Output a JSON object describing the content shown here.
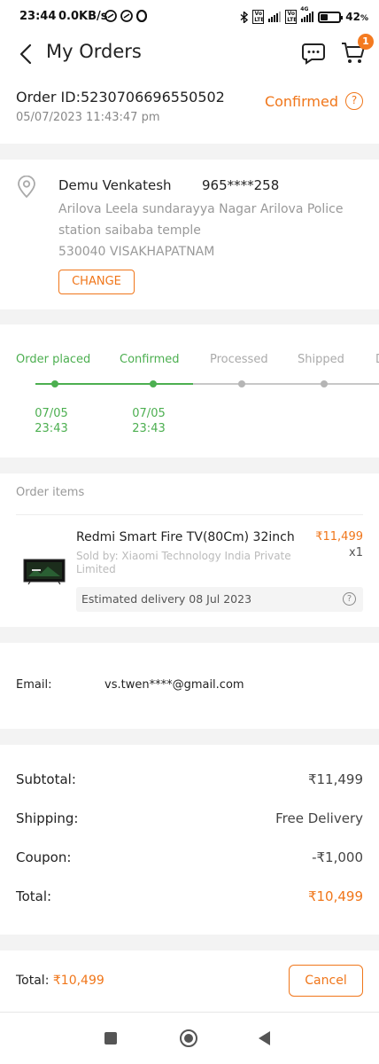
{
  "status_bar": {
    "time": "23:44",
    "speed": "0.0KB/s",
    "battery": "42",
    "battery_unit": "%",
    "network": "4G",
    "volte_1": "Vo LTE",
    "volte_2": "Vo LTE",
    "battery_level": 0.42
  },
  "header": {
    "title": "My Orders",
    "cart_count": "1"
  },
  "order": {
    "id": "Order ID:5230706696550502",
    "date": "05/07/2023 11:43:47 pm",
    "status": "Confirmed"
  },
  "address": {
    "name": "Demu Venkatesh",
    "phone": "965****258",
    "line": "Arilova Leela sundarayya Nagar Arilova Police station saibaba temple",
    "city": "530040 VISAKHAPATNAM",
    "change_label": "CHANGE"
  },
  "tracker": {
    "steps": [
      {
        "label": "Order placed",
        "done": true,
        "date": "07/05",
        "time": "23:43"
      },
      {
        "label": "Confirmed",
        "done": true,
        "date": "07/05",
        "time": "23:43"
      },
      {
        "label": "Processed",
        "done": false
      },
      {
        "label": "Shipped",
        "done": false
      },
      {
        "label": "D",
        "done": false
      }
    ],
    "done_color": "#4caf50",
    "todo_color": "#c8c8c8"
  },
  "items": {
    "title": "Order items",
    "product": {
      "name": "Redmi Smart Fire TV(80Cm) 32inch",
      "price": "₹11,499",
      "qty": "x1",
      "seller": "Sold by: Xiaomi Technology India Private Limited",
      "estimated_delivery": "Estimated delivery 08 Jul 2023"
    }
  },
  "contact": {
    "email_label": "Email:",
    "email_value": "vs.twen****@gmail.com"
  },
  "summary": {
    "subtotal_label": "Subtotal:",
    "subtotal_value": "₹11,499",
    "shipping_label": "Shipping:",
    "shipping_value": "Free Delivery",
    "coupon_label": "Coupon:",
    "coupon_value": "-₹1,000",
    "total_label": "Total:",
    "total_value": "₹10,499"
  },
  "footer": {
    "total_label": "Total: ",
    "total_value": "₹10,499",
    "cancel_label": "Cancel"
  },
  "colors": {
    "accent": "#f0761a",
    "success": "#4caf50",
    "muted": "#999999"
  }
}
